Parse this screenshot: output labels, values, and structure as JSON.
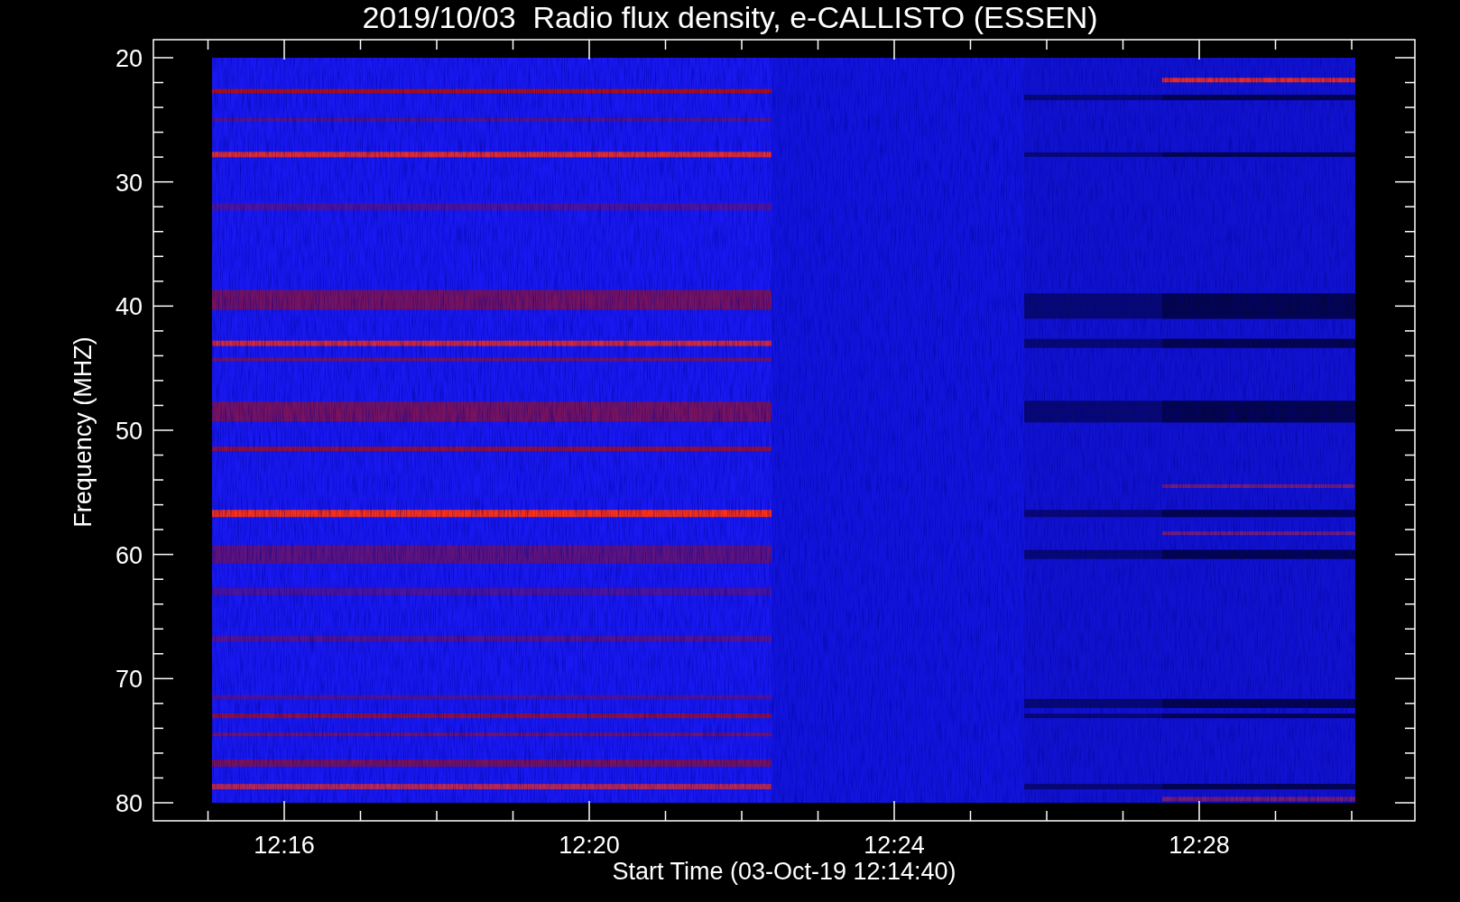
{
  "title": "2019/10/03  Radio flux density, e-CALLISTO (ESSEN)",
  "y_axis": {
    "label": "Frequency (MHZ)",
    "ticks": [
      "20",
      "30",
      "40",
      "50",
      "60",
      "70",
      "80"
    ]
  },
  "x_axis": {
    "label": "Start Time (03-Oct-19 12:14:40)",
    "ticks": [
      "12:16",
      "12:20",
      "12:24",
      "12:28"
    ]
  }
}
